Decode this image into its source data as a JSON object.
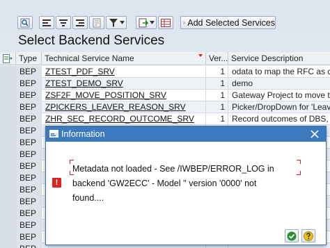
{
  "toolbar": {
    "add_selected_label": "Add Selected Services",
    "icons": [
      "find-icon",
      "align-left-icon",
      "align-center-icon",
      "align-right-icon",
      "details-icon",
      "filter-icon",
      "filter-dropdown-icon",
      "export-icon",
      "export-dropdown-icon",
      "layout-icon",
      "add-selected-icon"
    ]
  },
  "page": {
    "title": "Select Backend Services"
  },
  "table": {
    "columns": [
      "Type",
      "Technical Service Name",
      "Ver...",
      "Service Description"
    ],
    "sort_indicator_color": "#d22222",
    "rows": [
      {
        "type": "BEP",
        "name": "ZTEST_PDF_SRV",
        "version": "1",
        "description": "odata to map the RFC as da"
      },
      {
        "type": "BEP",
        "name": "ZTEST_DEMO_SRV",
        "version": "1",
        "description": "demo"
      },
      {
        "type": "BEP",
        "name": "ZSF2F_MOVE_POSITION_SRV",
        "version": "1",
        "description": "Gateway Project to move th"
      },
      {
        "type": "BEP",
        "name": "ZPICKERS_LEAVER_REASON_SRV",
        "version": "1",
        "description": "Picker/DropDown for 'Leave"
      },
      {
        "type": "BEP",
        "name": "ZHR_SEC_RECORD_OUTCOME_SRV",
        "version": "1",
        "description": "Record outcomes of DBS, P"
      },
      {
        "type": "BEP",
        "name": "",
        "version": "",
        "description": ""
      },
      {
        "type": "BEP",
        "name": "",
        "version": "",
        "description": ""
      },
      {
        "type": "BEP",
        "name": "",
        "version": "",
        "description": ""
      },
      {
        "type": "BEP",
        "name": "",
        "version": "",
        "description": ""
      },
      {
        "type": "BEP",
        "name": "",
        "version": "",
        "description": ""
      },
      {
        "type": "BEP",
        "name": "",
        "version": "",
        "description": ""
      },
      {
        "type": "BEP",
        "name": "",
        "version": "",
        "description": ""
      },
      {
        "type": "BEP",
        "name": "",
        "version": "",
        "description": ""
      },
      {
        "type": "BEP",
        "name": "",
        "version": "",
        "description": ""
      },
      {
        "type": "BEP",
        "name": "",
        "version": "",
        "description": ""
      },
      {
        "type": "BEP",
        "name": "",
        "version": "",
        "description": ""
      }
    ]
  },
  "dialog": {
    "title": "Information",
    "message_line1": "Metadata not loaded - See /IWBEP/ERROR_LOG in",
    "message_line2": "backend 'GW2ECC' - Model '' version '0000' not",
    "message_line3": "found....",
    "colors": {
      "title_bar": "#3d79bd",
      "error": "#d22222",
      "ok": "#2e8b2e"
    }
  }
}
